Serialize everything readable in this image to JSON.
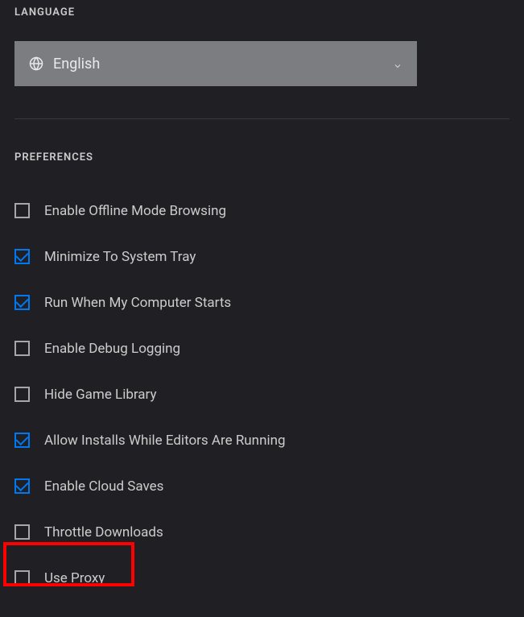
{
  "language": {
    "title": "LANGUAGE",
    "selected": "English"
  },
  "preferences": {
    "title": "PREFERENCES",
    "items": [
      {
        "label": "Enable Offline Mode Browsing",
        "checked": false
      },
      {
        "label": "Minimize To System Tray",
        "checked": true
      },
      {
        "label": "Run When My Computer Starts",
        "checked": true
      },
      {
        "label": "Enable Debug Logging",
        "checked": false
      },
      {
        "label": "Hide Game Library",
        "checked": false
      },
      {
        "label": "Allow Installs While Editors Are Running",
        "checked": true
      },
      {
        "label": "Enable Cloud Saves",
        "checked": true
      },
      {
        "label": "Throttle Downloads",
        "checked": false
      },
      {
        "label": "Use Proxy",
        "checked": false
      }
    ]
  }
}
